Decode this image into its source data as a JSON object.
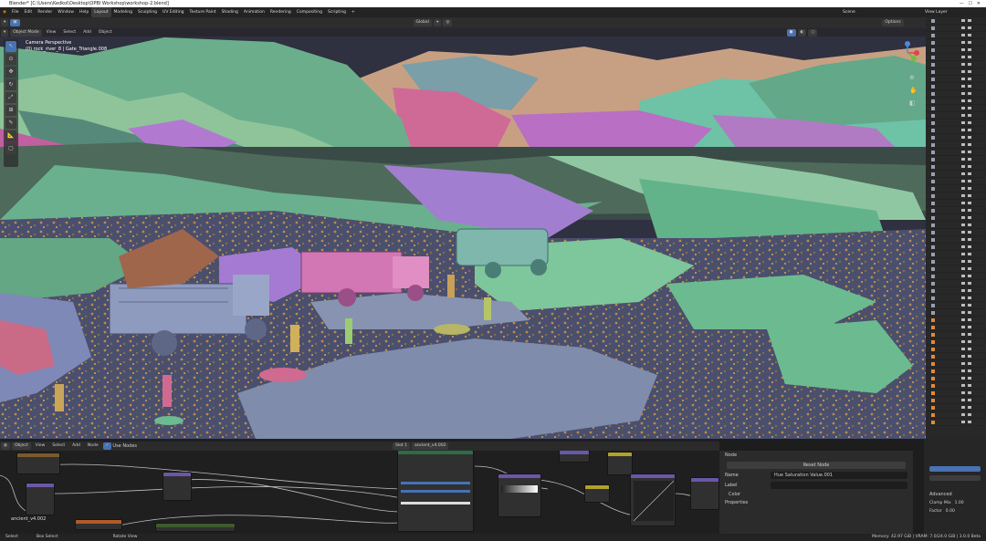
{
  "window": {
    "title": "Blender* [C:\\Users\\Kedkol\\Desktop\\OPBI Workshop\\workshop-2.blend]"
  },
  "menu": {
    "items": [
      "File",
      "Edit",
      "Render",
      "Window",
      "Help"
    ]
  },
  "workspaces": {
    "tabs": [
      "Layout",
      "Modeling",
      "Sculpting",
      "UV Editing",
      "Texture Paint",
      "Shading",
      "Animation",
      "Rendering",
      "Compositing",
      "Scripting"
    ],
    "active": "Layout",
    "add": "+"
  },
  "scene": {
    "label": "Scene",
    "view_layer": "View Layer"
  },
  "header": {
    "orientation": "Global",
    "options": "Options"
  },
  "viewport_header": {
    "mode": "Object Mode",
    "menus": [
      "View",
      "Select",
      "Add",
      "Object"
    ]
  },
  "viewport": {
    "title": "Camera Perspective",
    "subtitle": "(0) rock_river_8 | Gate_Triangle.008"
  },
  "tools": [
    "select",
    "cursor",
    "move",
    "rotate",
    "scale",
    "transform",
    "annotate",
    "measure",
    "add-cube"
  ],
  "node_editor": {
    "editor_type": "Object",
    "menus": [
      "View",
      "Select",
      "Add",
      "Node"
    ],
    "use_nodes_label": "Use Nodes",
    "slot": "Slot 1",
    "material": "ancient_v4.002",
    "frame_label": "ancient_v4.002"
  },
  "n_panel": {
    "section_node": "Node",
    "reset_button": "Reset Node",
    "name_label": "Name",
    "name_value": "Hue Saturation Value.001",
    "label_label": "Label",
    "color_section": "Color",
    "properties_section": "Properties"
  },
  "right_panel": {
    "advanced": "Advanced",
    "clamp": "Clamp Mix",
    "clamp_value": "1.00",
    "fac": "Factor",
    "fac_value": "0.00"
  },
  "status": {
    "left": [
      "Select",
      "Box Select",
      "Rotate View"
    ],
    "right": "Memory: 42.97 GiB | VRAM: 7.0/24.0 GiB | 3.0.0 Beta"
  },
  "colors": {
    "accent": "#4772b3",
    "header": "#2d2d2d",
    "viewport_sky": "#3a3a3a"
  }
}
